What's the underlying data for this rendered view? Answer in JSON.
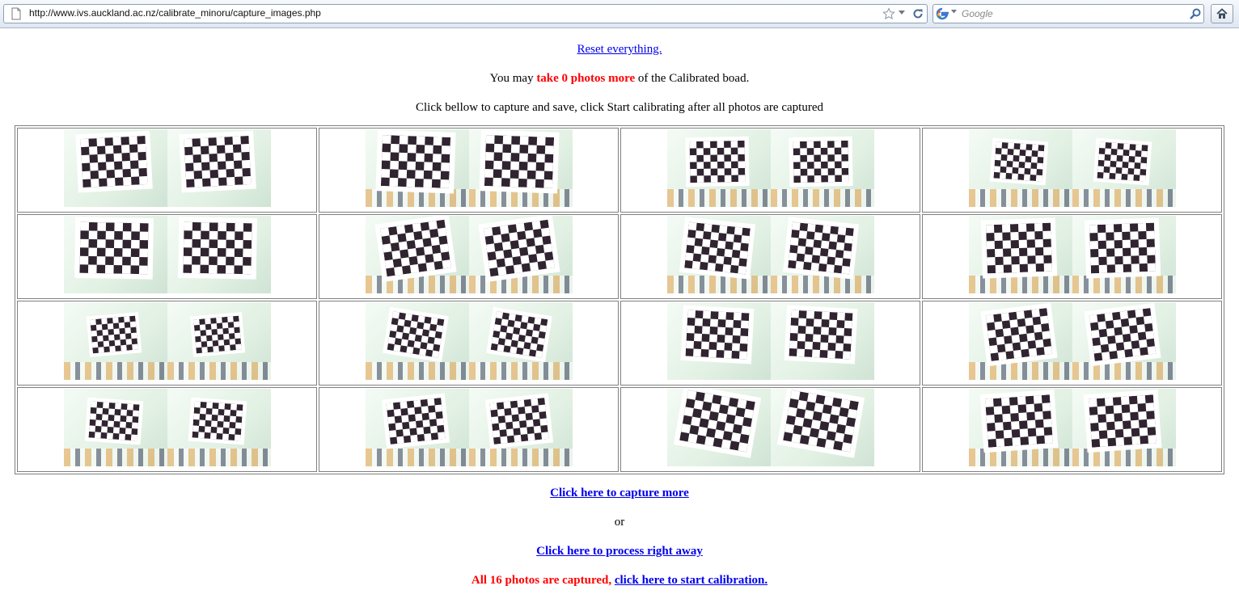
{
  "browser": {
    "url": "http://www.ivs.auckland.ac.nz/calibrate_minoru/capture_images.php",
    "search_placeholder": "Google"
  },
  "page": {
    "reset_link": "Reset everything.",
    "status_prefix": "You may ",
    "status_highlight": "take 0 photos more",
    "status_suffix": " of the Calibrated boad.",
    "instructions": "Click bellow to capture and save, click Start calibrating after all photos are captured",
    "capture_more_link": "Click here to capture more",
    "or_text": "or",
    "process_link": "Click here to process right away",
    "all_captured_text": "All 16 photos are captured, ",
    "start_calibration_link": "click here to start calibration."
  },
  "thumbnails": {
    "rows": 4,
    "columns": 4,
    "count": 16,
    "content": "stereo-pair-checkerboard-photo"
  },
  "colors": {
    "link": "#0000ee",
    "highlight_red": "#ff0000",
    "checker_dark": "#2f2430"
  }
}
